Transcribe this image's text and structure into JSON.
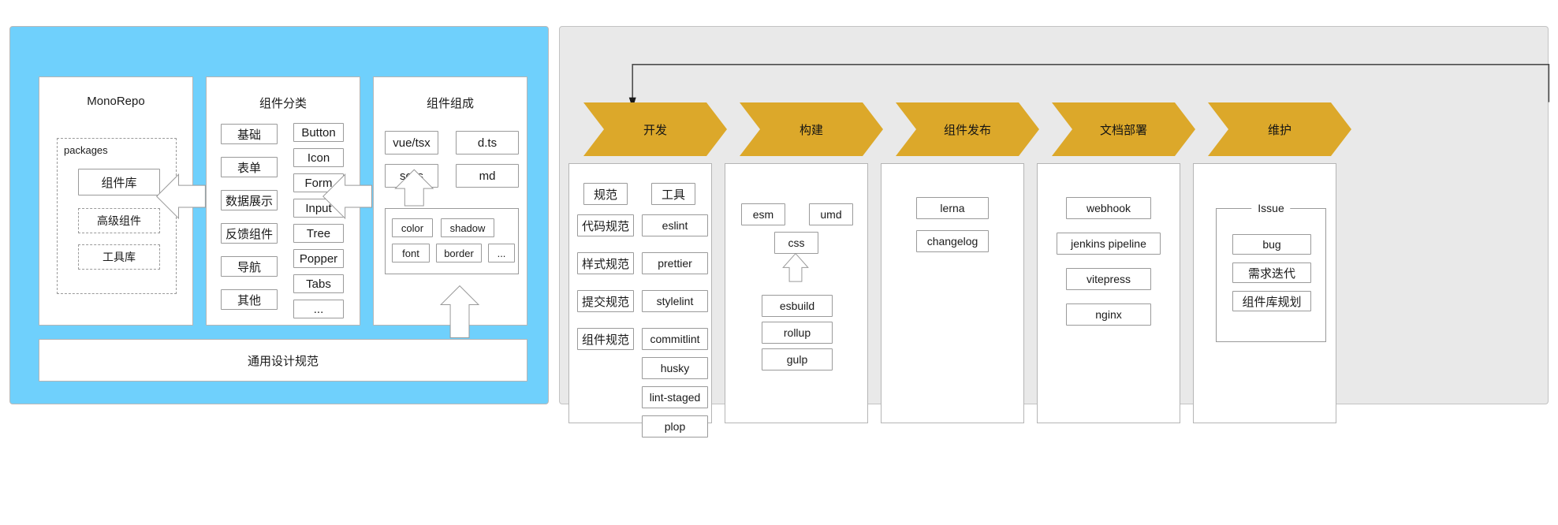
{
  "left_panel": {
    "columns": [
      {
        "title": "MonoRepo",
        "packages_label": "packages",
        "items": [
          {
            "label": "组件库",
            "style": "solid"
          },
          {
            "label": "高级组件",
            "style": "dashed"
          },
          {
            "label": "工具库",
            "style": "dashed"
          }
        ]
      },
      {
        "title": "组件分类",
        "left_items": [
          "基础",
          "表单",
          "数据展示",
          "反馈组件",
          "导航",
          "其他"
        ],
        "right_items": [
          "Button",
          "Icon",
          "Form",
          "Input",
          "Tree",
          "Popper",
          "Tabs",
          "..."
        ]
      },
      {
        "title": "组件组成",
        "files": [
          "vue/tsx",
          "d.ts",
          "scss",
          "md"
        ],
        "tokens": [
          "color",
          "shadow",
          "font",
          "border",
          "..."
        ]
      }
    ],
    "design_spec": "通用设计规范"
  },
  "right_panel": {
    "stages": [
      {
        "name": "开发",
        "left_items": [
          "规范",
          "代码规范",
          "样式规范",
          "提交规范",
          "组件规范"
        ],
        "right_items": [
          "工具",
          "eslint",
          "prettier",
          "stylelint",
          "commitlint",
          "husky",
          "lint-staged",
          "plop"
        ]
      },
      {
        "name": "构建",
        "outputs": [
          "esm",
          "umd",
          "css"
        ],
        "tools": [
          "esbuild",
          "rollup",
          "gulp"
        ]
      },
      {
        "name": "组件发布",
        "items": [
          "lerna",
          "changelog"
        ]
      },
      {
        "name": "文档部署",
        "items": [
          "webhook",
          "jenkins pipeline",
          "vitepress",
          "nginx"
        ]
      },
      {
        "name": "维护",
        "issue_title": "Issue",
        "issue_items": [
          "bug",
          "需求迭代",
          "组件库规划"
        ]
      }
    ]
  },
  "colors": {
    "left_panel_bg": "#6fd0fc",
    "right_panel_bg": "#e9e9e9",
    "chevron": "#dca82a",
    "box_border": "#9a9a9a",
    "text": "#1a1a1a"
  }
}
